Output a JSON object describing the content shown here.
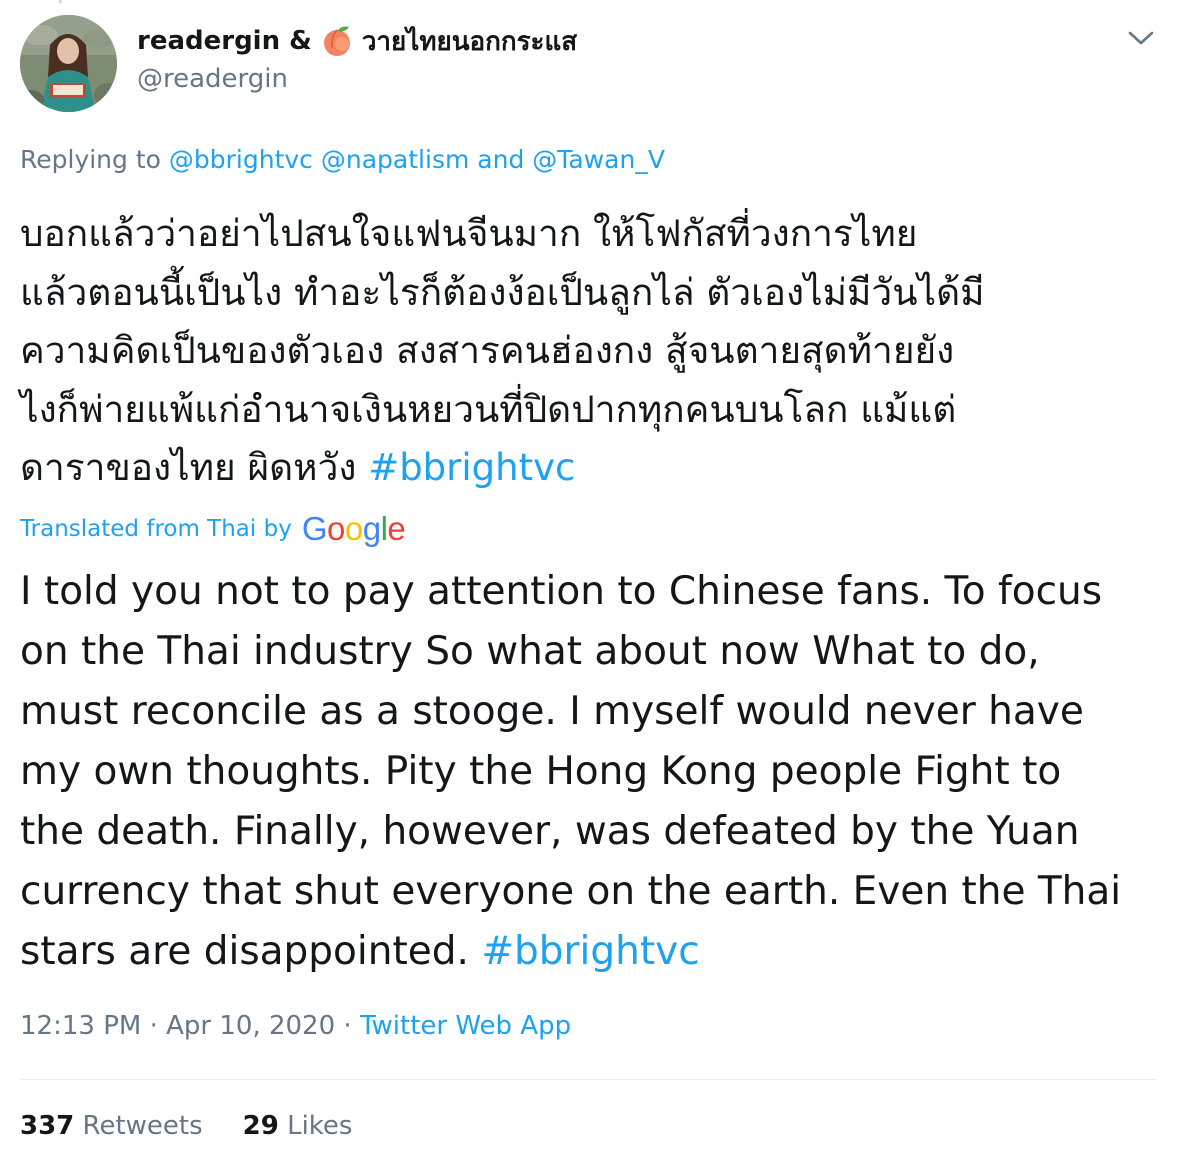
{
  "author": {
    "display_name_prefix": "readergin &",
    "emoji_icon": "peach-emoji-icon",
    "display_name_suffix": "วายไทยนอกกระแส",
    "handle": "@readergin"
  },
  "reply_context": {
    "prefix": "Replying to",
    "mention_1": "@bbrightvc",
    "mention_2": "@napatlism",
    "joiner": "and",
    "mention_3": "@Tawan_V"
  },
  "thai_body": {
    "line_1": "บอกแล้วว่าอย่าไปสนใจแฟนจีนมาก ให้โฟกัสที่วงการไทย",
    "line_2": "แล้วตอนนี้เป็นไง ทำอะไรก็ต้องง้อเป็นลูกไล่ ตัวเองไม่มีวันได้มี",
    "line_3": "ความคิดเป็นของตัวเอง สงสารคนฮ่องกง สู้จนตายสุดท้ายยัง",
    "line_4": "ไงก็พ่ายแพ้แก่อำนาจเงินหยวนที่ปิดปากทุกคนบนโลก แม้แต่",
    "line_5_text": "ดาราของไทย ผิดหวัง",
    "hashtag": "#bbrightvc"
  },
  "translation": {
    "label": "Translated from Thai by",
    "provider_letters": [
      "G",
      "o",
      "o",
      "g",
      "l",
      "e"
    ]
  },
  "english_body": {
    "line_1": "I told you not to pay attention to Chinese fans. To focus",
    "line_2": "on the Thai industry So what about now What to do,",
    "line_3": "must reconcile as a stooge. I myself would never have",
    "line_4": "my own thoughts. Pity the Hong Kong people Fight to",
    "line_5": "the death. Finally, however, was defeated by the Yuan",
    "line_6": "currency that shut everyone on the earth. Even the Thai",
    "line_7_text": "stars are disappointed.",
    "hashtag": "#bbrightvc"
  },
  "meta": {
    "time": "12:13 PM",
    "separator": "·",
    "date": "Apr 10, 2020",
    "app": "Twitter Web App"
  },
  "stats": {
    "retweets_count": "337",
    "retweets_label": "Retweets",
    "likes_count": "29",
    "likes_label": "Likes"
  },
  "colors": {
    "link_blue": "#1da1f2",
    "secondary_gray": "#657786",
    "text_dark": "#14171a",
    "divider": "#e6ecf0"
  }
}
